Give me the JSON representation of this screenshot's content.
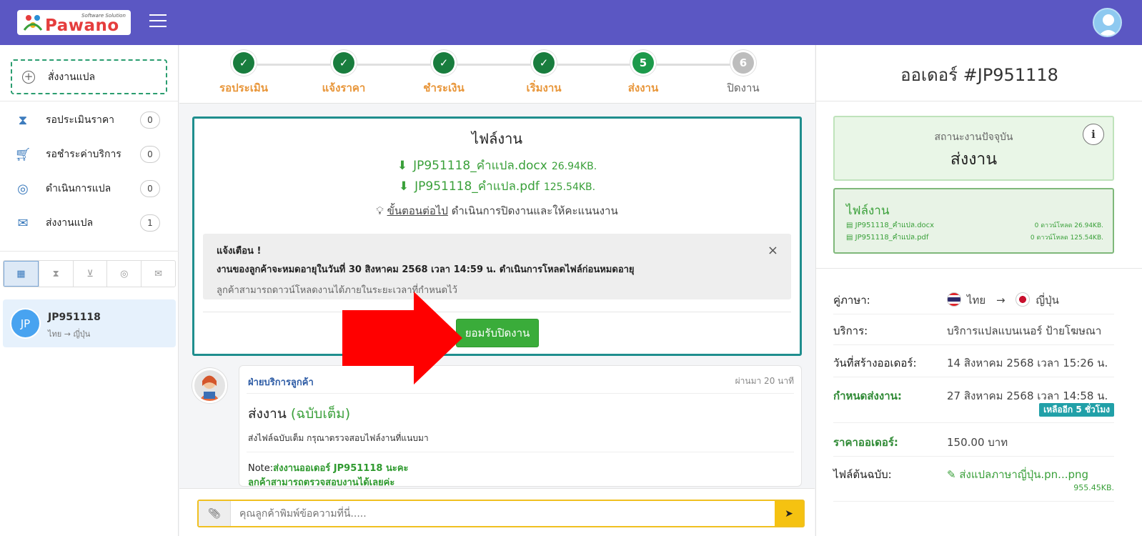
{
  "header": {
    "logo_text": "Pawano",
    "logo_tagline": "Software Solution",
    "menu_icon": "hamburger-icon",
    "avatar_icon": "user-avatar-icon",
    "brand_color": "#5b57c3"
  },
  "sidebar": {
    "new_job_label": "สั่งงานแปล",
    "items": [
      {
        "label": "รอประเมินราคา",
        "count": "0",
        "icon": "hourglass-icon"
      },
      {
        "label": "รอชำระค่าบริการ",
        "count": "0",
        "icon": "cart-icon"
      },
      {
        "label": "ดำเนินการแปล",
        "count": "0",
        "icon": "globe-icon"
      },
      {
        "label": "ส่งงานแปล",
        "count": "1",
        "icon": "inbox-icon"
      }
    ],
    "filter_tabs": [
      "grid-icon",
      "hourglass-icon",
      "cart-icon",
      "globe-icon",
      "inbox-icon"
    ],
    "job": {
      "avatar": "JP",
      "id": "JP951118",
      "lang": "ไทย → ญี่ปุ่น"
    }
  },
  "steps": [
    {
      "label": "รอประเมิน",
      "mark": "✓",
      "state": "done"
    },
    {
      "label": "แจ้งราคา",
      "mark": "✓",
      "state": "done"
    },
    {
      "label": "ชำระเงิน",
      "mark": "✓",
      "state": "done"
    },
    {
      "label": "เริ่มงาน",
      "mark": "✓",
      "state": "done"
    },
    {
      "label": "ส่งงาน",
      "mark": "5",
      "state": "current"
    },
    {
      "label": "ปิดงาน",
      "mark": "6",
      "state": "pending"
    }
  ],
  "filebox": {
    "title": "ไฟล์งาน",
    "files": [
      {
        "name": "JP951118_คำแปล.docx",
        "size": "26.94KB."
      },
      {
        "name": "JP951118_คำแปล.pdf",
        "size": "125.54KB."
      }
    ],
    "next_label": "ขั้นตอนต่อไป",
    "next_text": "ดำเนินการปิดงานและให้คะแนนงาน",
    "alert_title": "แจ้งเตือน !",
    "alert_line": "งานของลูกค้าจะหมดอายุในวันที่ 30 สิงหาคม 2568 เวลา 14:59 น. ดำเนินการโหลดไฟล์ก่อนหมดอายุ",
    "alert_sub": "ลูกค้าสามารถดาวน์โหลดงานได้ภายในระยะเวลาที่กำหนดไว้",
    "close": "×",
    "accept_button": "ยอมรับปิดงาน"
  },
  "message": {
    "from": "ฝ่ายบริการลูกค้า",
    "ago": "ผ่านมา 20 นาที",
    "title": "ส่งงาน",
    "title_tag": "(ฉบับเต็ม)",
    "body": "ส่งไฟล์ฉบับเต็ม กรุณาตรวจสอบไฟล์งานที่แนบมา",
    "note_label": "Note:",
    "note_text": "ส่งงานออเดอร์ JP951118 นะคะ",
    "note_text2": "ลูกค้าสามารถตรวจสอบงานได้เลยค่ะ"
  },
  "compose": {
    "placeholder": "คุณลูกค้าพิมพ์ข้อความที่นี่.....",
    "attach_icon": "paperclip-icon",
    "send_icon": "send-icon"
  },
  "right": {
    "order_title": "ออเดอร์ #JP951118",
    "status_label": "สถานะงานปัจจุบัน",
    "status_value": "ส่งงาน",
    "info_icon": "ℹ",
    "files_title": "ไฟล์งาน",
    "files": [
      {
        "name": "JP951118_คำแปล.docx",
        "meta": "0 ดาวน์โหลด 26.94KB."
      },
      {
        "name": "JP951118_คำแปล.pdf",
        "meta": "0 ดาวน์โหลด 125.54KB."
      }
    ],
    "lang_label": "คู่ภาษา:",
    "lang_from": "ไทย",
    "lang_arrow": "→",
    "lang_to": "ญี่ปุ่น",
    "service_label": "บริการ:",
    "service_value": "บริการแปลแบนเนอร์ ป้ายโฆษณา",
    "created_label": "วันที่สร้างออเดอร์:",
    "created_value": "14 สิงหาคม 2568 เวลา 15:26 น.",
    "due_label": "กำหนดส่งงาน:",
    "due_value": "27 สิงหาคม 2568 เวลา 14:58 น.",
    "due_badge": "เหลืออีก 5 ชั่วโมง",
    "price_label": "ราคาออเดอร์:",
    "price_value": "150.00 บาท",
    "source_label": "ไฟล์ต้นฉบับ:",
    "source_value": "ส่งแปลภาษาญี่ปุ่น.pn...png",
    "source_size": "955.45KB."
  }
}
